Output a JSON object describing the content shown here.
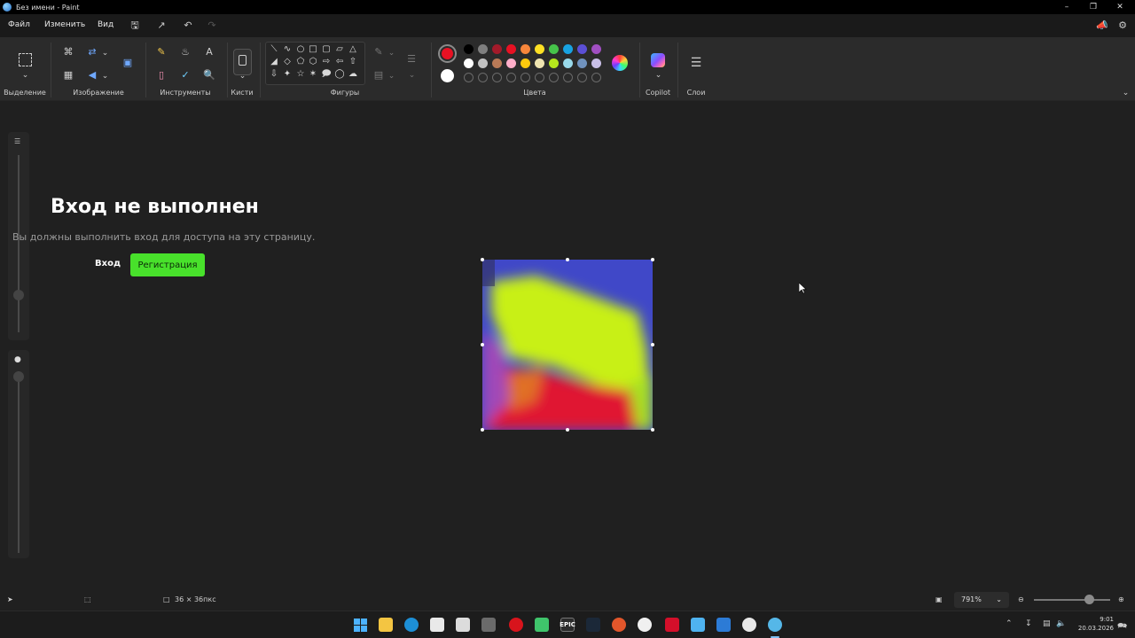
{
  "window": {
    "title": "Без имени - Paint"
  },
  "menu": {
    "file": "Файл",
    "edit": "Изменить",
    "view": "Вид"
  },
  "ribbon": {
    "groups": {
      "selection": "Выделение",
      "image": "Изображение",
      "tools": "Инструменты",
      "brushes": "Кисти",
      "shapes": "Фигуры",
      "colors": "Цвета",
      "copilot": "Copilot",
      "layers": "Слои"
    },
    "primary_color": "#e81123",
    "secondary_color": "#ffffff",
    "palette_row1": [
      "#000000",
      "#7f7f7f",
      "#a31a2a",
      "#e81123",
      "#f7863b",
      "#fde024",
      "#46c34a",
      "#18a3e2",
      "#5b4fd6",
      "#a14fc2"
    ],
    "palette_row2": [
      "#ffffff",
      "#c3c3c3",
      "#b97a57",
      "#ffaec9",
      "#ffc90e",
      "#efe4b0",
      "#b5e61d",
      "#99d9ea",
      "#7092be",
      "#c8bfe7"
    ]
  },
  "overlay": {
    "title": "Вход не выполнен",
    "subtitle": "Вы должны выполнить вход для доступа на эту страницу.",
    "login": "Вход",
    "register": "Регистрация"
  },
  "status": {
    "canvas_size": "36 × 36пкс",
    "zoom": "791%",
    "zoom_slider_fraction": 0.72
  },
  "taskbar": {
    "time": "9:01",
    "date": "20.03.2026"
  }
}
